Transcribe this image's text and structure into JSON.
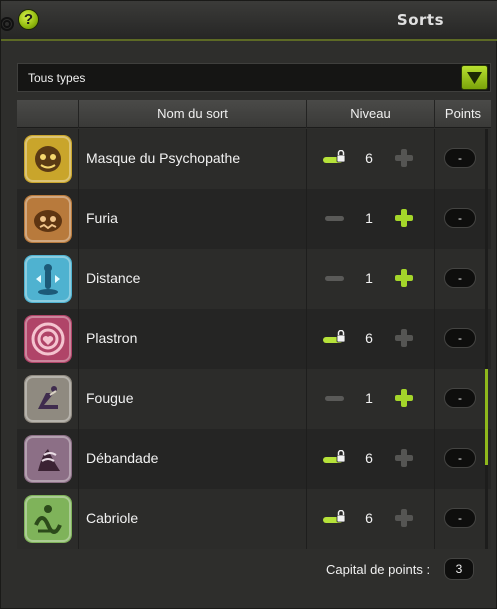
{
  "window": {
    "title": "Sorts"
  },
  "filter": {
    "selected": "Tous types"
  },
  "table": {
    "headers": {
      "name": "Nom du sort",
      "level": "Niveau",
      "points": "Points"
    },
    "rows": [
      {
        "name": "Masque du Psychopathe",
        "level": "6",
        "locked": true,
        "points": "-",
        "icon": "mask-icon",
        "color": "#c9a52b"
      },
      {
        "name": "Furia",
        "level": "1",
        "locked": false,
        "points": "-",
        "icon": "furia-icon",
        "color": "#b87a3c"
      },
      {
        "name": "Distance",
        "level": "1",
        "locked": false,
        "points": "-",
        "icon": "distance-icon",
        "color": "#4fb2d0"
      },
      {
        "name": "Plastron",
        "level": "6",
        "locked": true,
        "points": "-",
        "icon": "plastron-icon",
        "color": "#b04468"
      },
      {
        "name": "Fougue",
        "level": "1",
        "locked": false,
        "points": "-",
        "icon": "fougue-icon",
        "color": "#8f8a80"
      },
      {
        "name": "Débandade",
        "level": "6",
        "locked": true,
        "points": "-",
        "icon": "debandade-icon",
        "color": "#8c6f86"
      },
      {
        "name": "Cabriole",
        "level": "6",
        "locked": true,
        "points": "-",
        "icon": "cabriole-icon",
        "color": "#7fb35a"
      }
    ]
  },
  "footer": {
    "capital_label": "Capital de points :",
    "capital_value": "3"
  },
  "colors": {
    "accent": "#9bc41c",
    "background": "#2e2e2c"
  }
}
